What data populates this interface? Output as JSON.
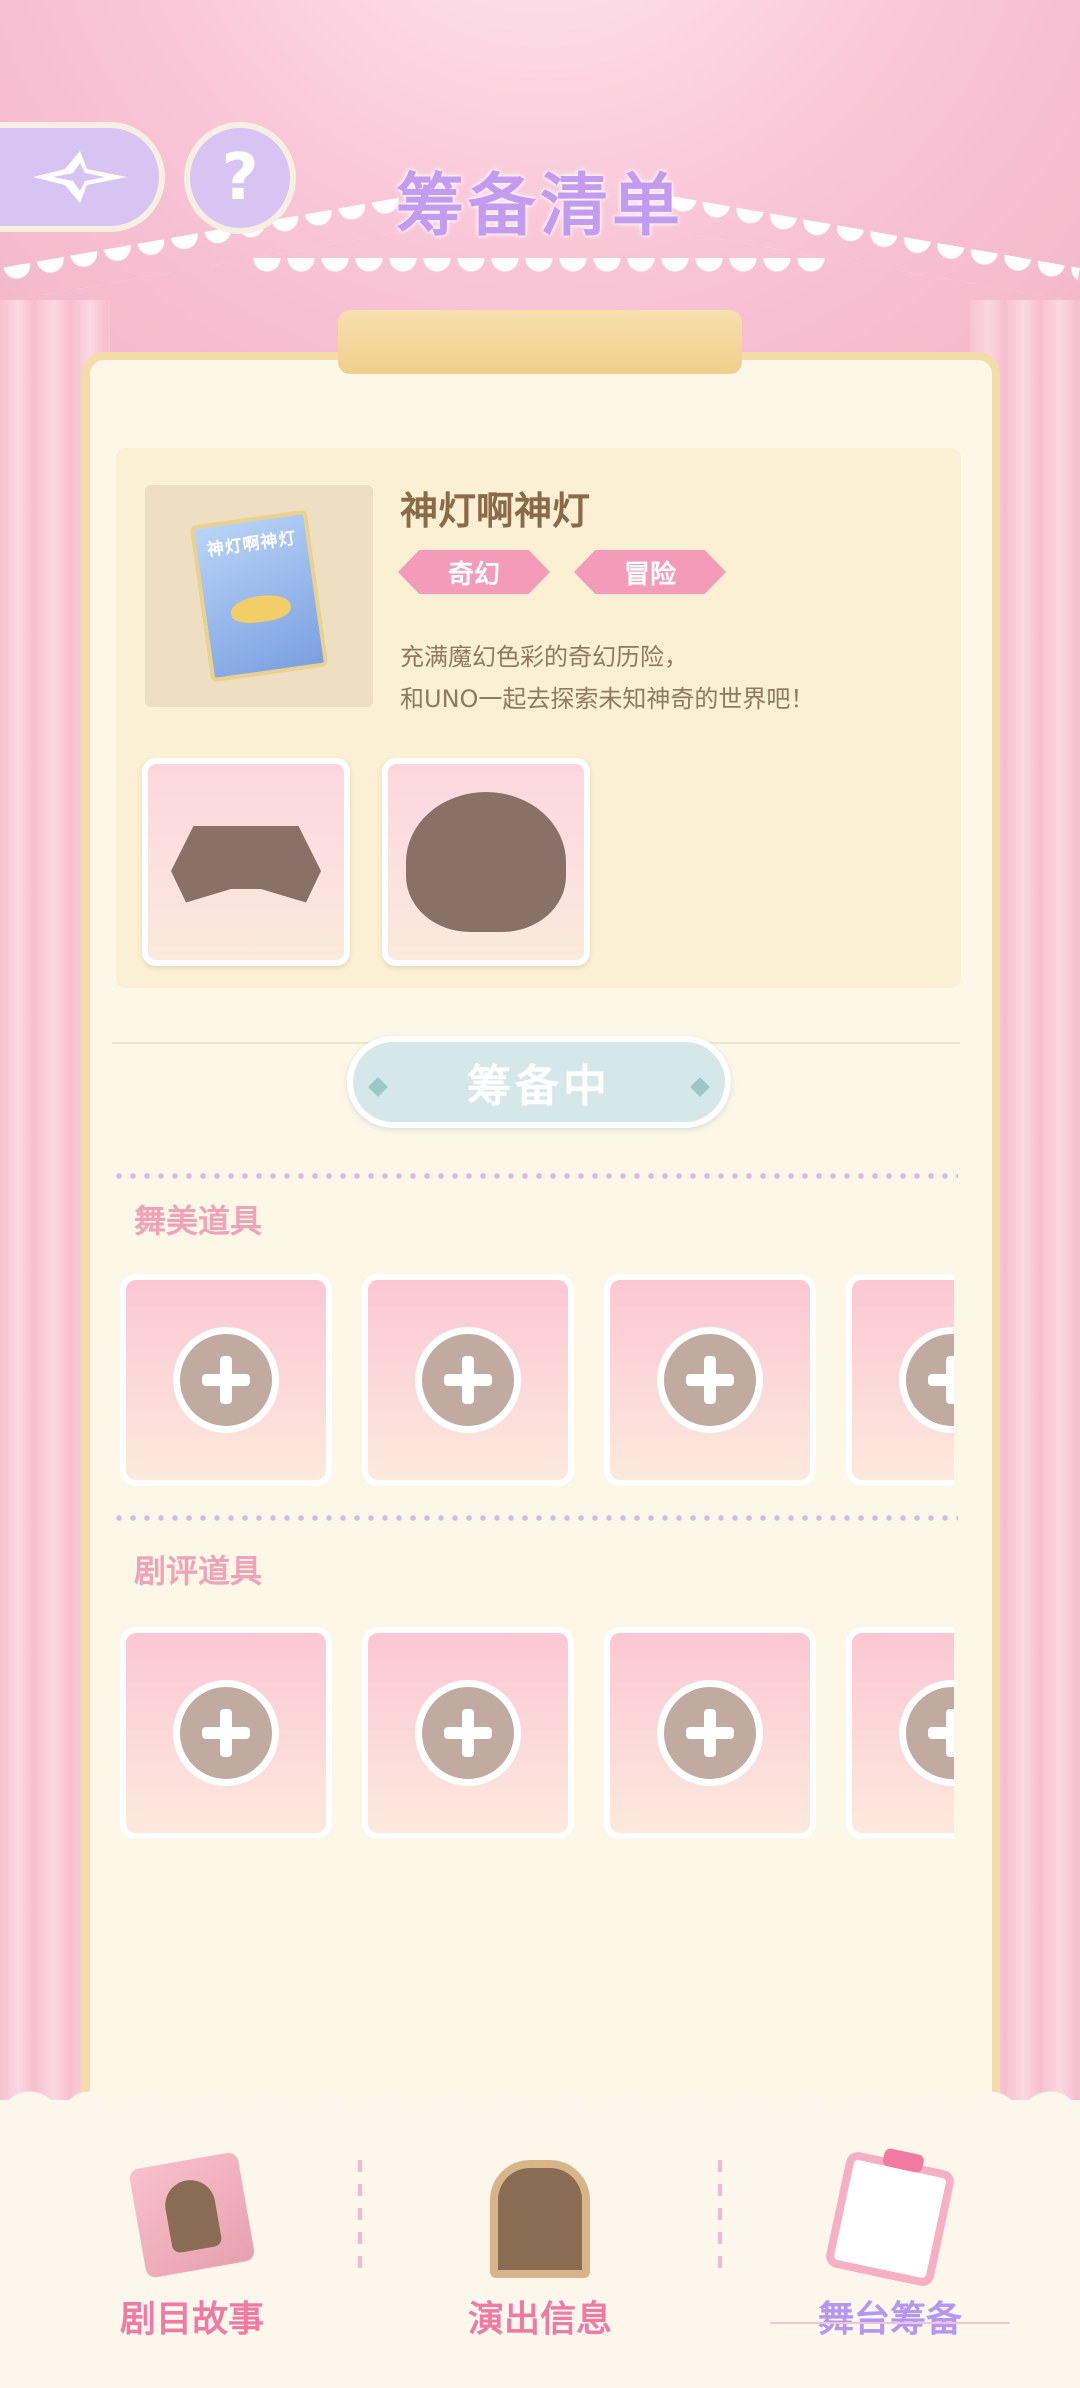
{
  "header": {
    "title": "筹备清单",
    "back_icon": "sparkle-arrow-back-icon",
    "help_label": "?"
  },
  "story": {
    "cover_text": "神灯啊神灯",
    "title": "神灯啊神灯",
    "tags": [
      "奇幻",
      "冒险"
    ],
    "description_lines": [
      "充满魔幻色彩的奇幻历险，",
      "和UNO一起去探索未知神奇的世界吧！"
    ],
    "reward_items": [
      "locked-top-silhouette",
      "locked-hat-silhouette"
    ]
  },
  "status": {
    "label": "筹备中"
  },
  "sections": [
    {
      "label": "舞美道具",
      "slots": 4
    },
    {
      "label": "剧评道具",
      "slots": 4
    }
  ],
  "bottom_nav": [
    {
      "label": "剧目故事",
      "icon": "story-book-icon",
      "active": false
    },
    {
      "label": "演出信息",
      "icon": "info-board-icon",
      "active": false
    },
    {
      "label": "舞台筹备",
      "icon": "clipboard-icon",
      "active": true
    }
  ],
  "colors": {
    "title": "#c39cf0",
    "tag": "#f39bb8",
    "section_label": "#f0a2b8",
    "status_pill": "#d4e8ea",
    "nav_label": "#f07aa0",
    "nav_label_active": "#b596f0"
  }
}
